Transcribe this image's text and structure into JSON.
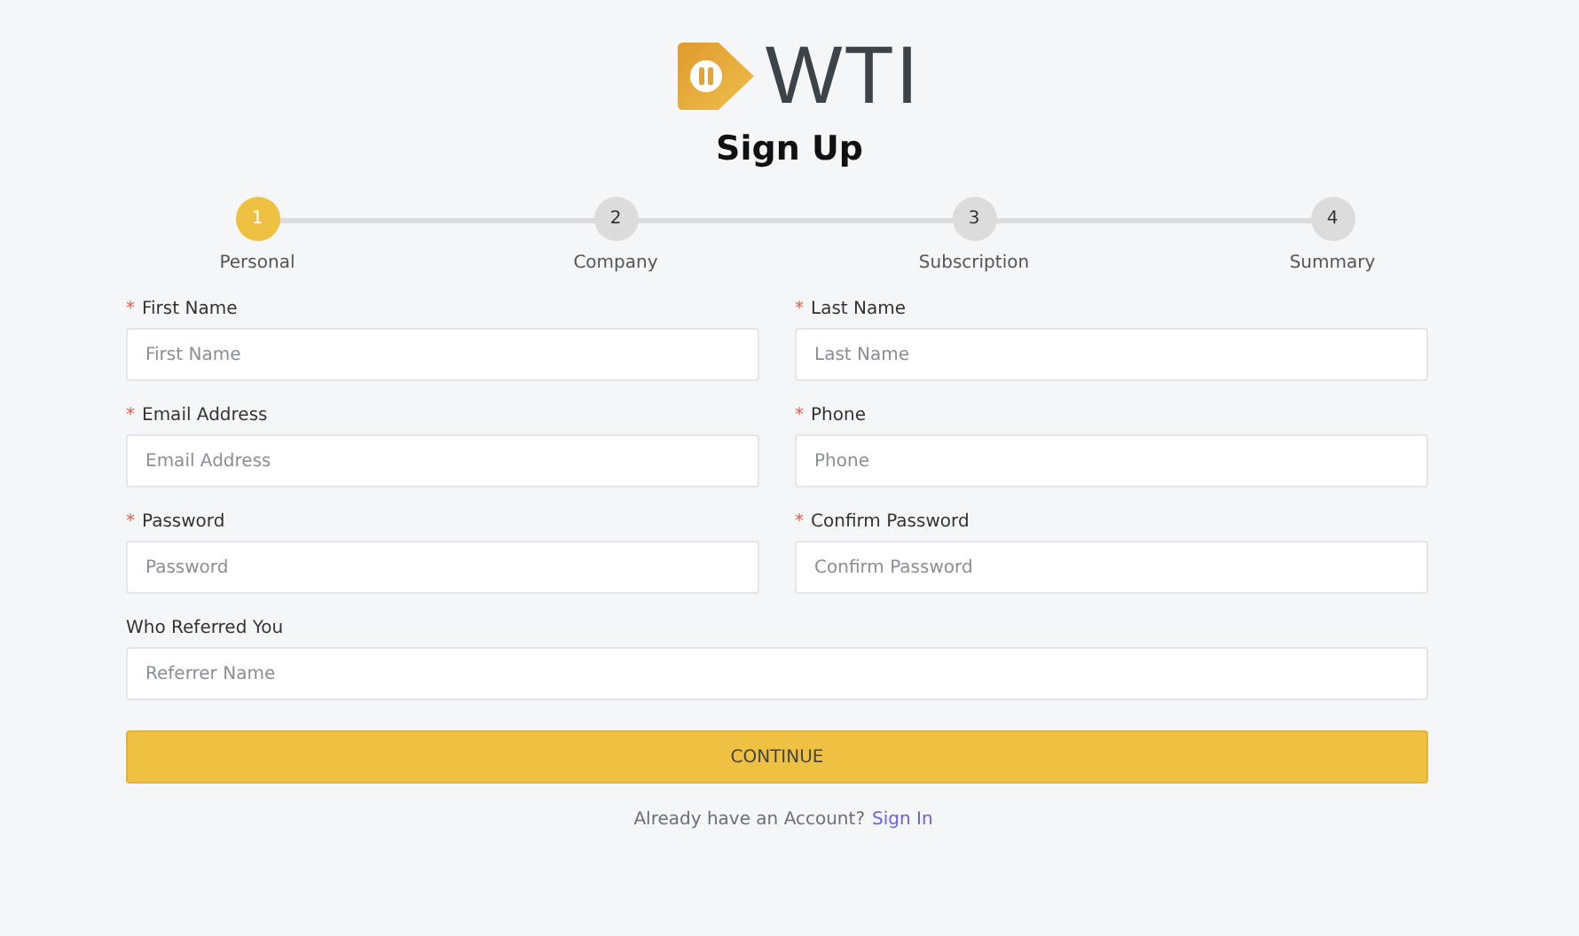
{
  "logo": {
    "text": "WTI"
  },
  "title": "Sign Up",
  "steps": [
    {
      "number": "1",
      "label": "Personal",
      "selected": true
    },
    {
      "number": "2",
      "label": "Company",
      "selected": false
    },
    {
      "number": "3",
      "label": "Subscription",
      "selected": false
    },
    {
      "number": "4",
      "label": "Summary",
      "selected": false
    }
  ],
  "fields": [
    {
      "label": "First Name",
      "required_mark": "*",
      "placeholder": "First Name",
      "kind": "half"
    },
    {
      "label": "Last Name",
      "required_mark": "*",
      "placeholder": "Last Name",
      "kind": "half"
    },
    {
      "label": "Email Address",
      "required_mark": "*",
      "placeholder": "Email Address",
      "kind": "half"
    },
    {
      "label": "Phone",
      "required_mark": "*",
      "placeholder": "Phone",
      "kind": "half"
    },
    {
      "label": "Password",
      "required_mark": "*",
      "placeholder": "Password",
      "kind": "half"
    },
    {
      "label": "Confirm Password",
      "required_mark": "*",
      "placeholder": "Confirm Password",
      "kind": "half"
    },
    {
      "label": "Who Referred You",
      "placeholder": "Referrer Name",
      "kind": "full"
    }
  ],
  "continue_button": "CONTINUE",
  "footer": {
    "text": "Already have an Account?",
    "link": "Sign In"
  }
}
